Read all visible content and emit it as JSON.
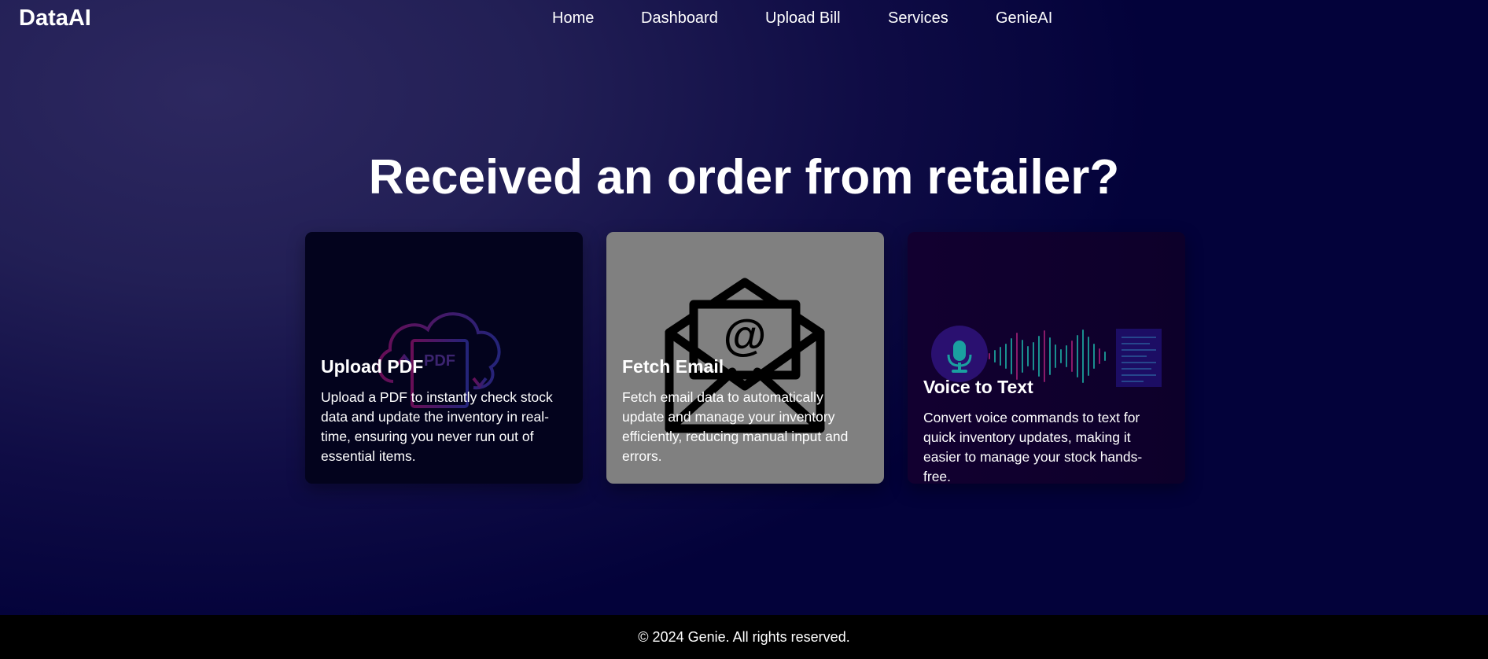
{
  "nav": {
    "brand": "DataAI",
    "links": [
      {
        "label": "Home"
      },
      {
        "label": "Dashboard"
      },
      {
        "label": "Upload Bill"
      },
      {
        "label": "Services"
      },
      {
        "label": "GenieAI"
      }
    ]
  },
  "hero": {
    "headline": "Received an order from retailer?"
  },
  "cards": [
    {
      "title": "Upload PDF",
      "description": "Upload a PDF to instantly check stock data and update the inventory in real-time, ensuring you never run out of essential items.",
      "icon": "cloud-pdf-upload-icon",
      "image_text": "PDF"
    },
    {
      "title": "Fetch Email",
      "description": "Fetch email data to automatically update and manage your inventory efficiently, reducing manual input and errors.",
      "icon": "open-envelope-at-icon",
      "image_text": "@"
    },
    {
      "title": "Voice to Text",
      "description": "Convert voice commands to text for quick inventory updates, making it easier to manage your stock hands-free.",
      "icon": "microphone-waveform-icon"
    }
  ],
  "footer": {
    "text": "© 2024 Genie. All rights reserved."
  },
  "colors": {
    "background_light": "#2d2860",
    "background_dark": "#03023a",
    "card_pdf": "#03031d",
    "card_email": "#808080",
    "card_voice": "#120030",
    "footer": "#000000",
    "accent_teal": "#1a8f8f",
    "accent_magenta": "#8a1a6a"
  }
}
